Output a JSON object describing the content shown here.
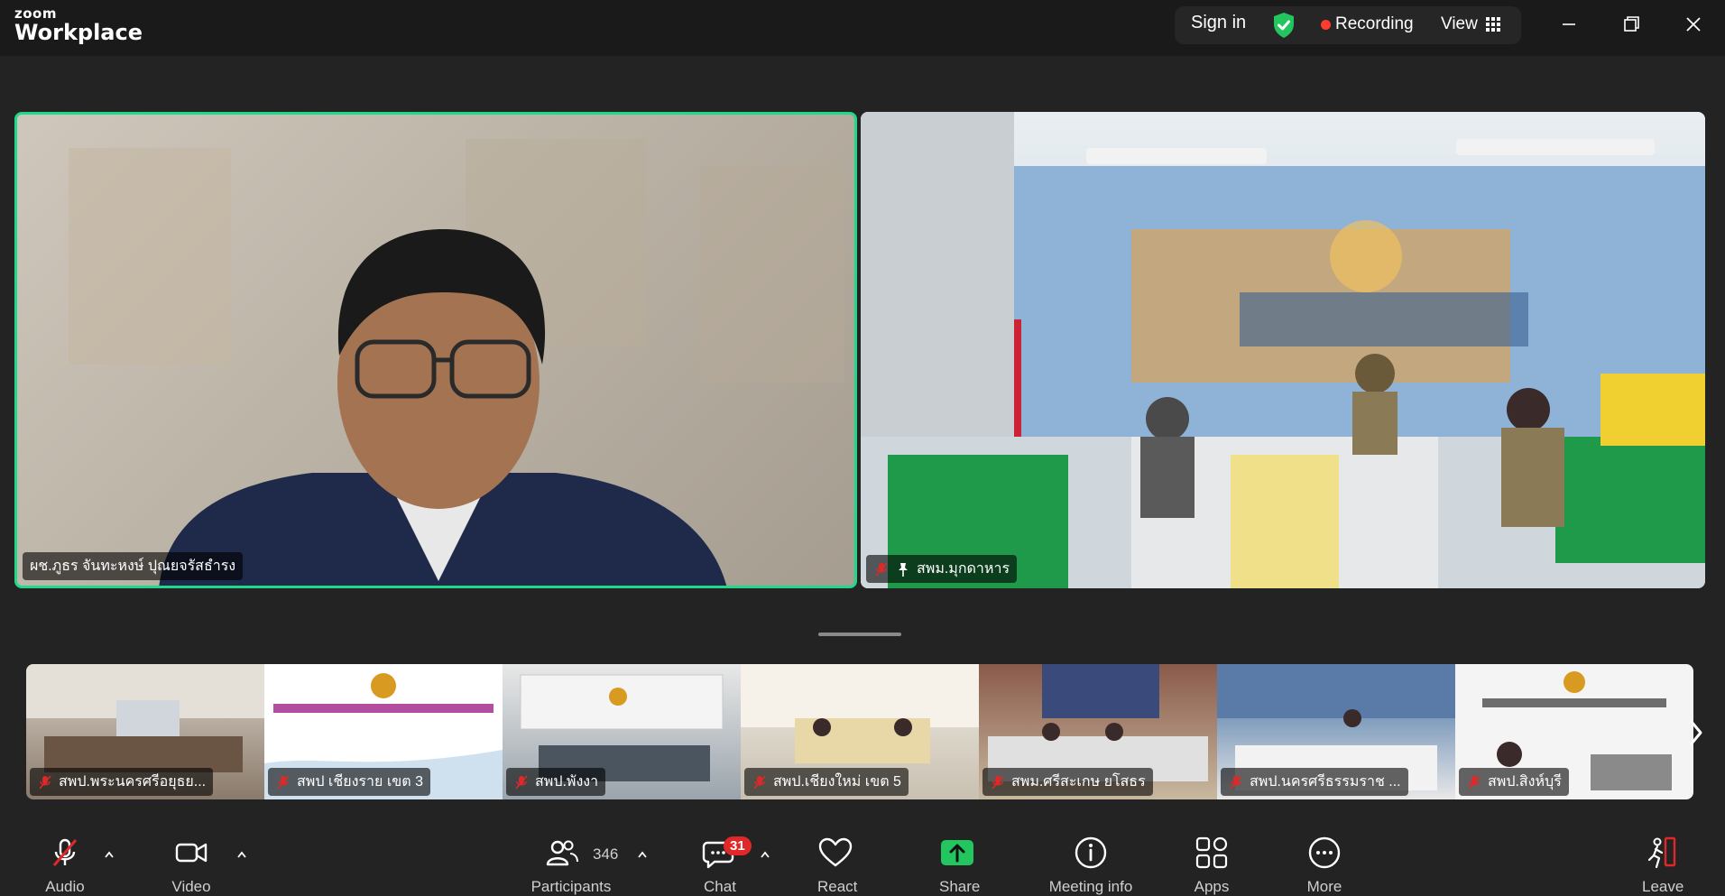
{
  "app": {
    "brand_small": "zoom",
    "brand_large": "Workplace"
  },
  "topbar": {
    "sign_in": "Sign in",
    "recording_label": "Recording",
    "view_label": "View",
    "colors": {
      "shield": "#22c55e",
      "record_dot": "#ff3b30"
    }
  },
  "main_tiles": [
    {
      "name": "ผช.ภูธร จันทะหงษ์ ปุณยจรัสธำรง",
      "active_speaker": true,
      "muted": false,
      "pinned": false
    },
    {
      "name": "สพม.มุกดาหาร",
      "active_speaker": false,
      "muted": true,
      "pinned": true
    }
  ],
  "filmstrip": [
    {
      "name": "สพป.พระนครศรีอยุธย..."
    },
    {
      "name": "สพป เชียงราย เขต 3"
    },
    {
      "name": "สพป.พังงา"
    },
    {
      "name": "สพป.เชียงใหม่ เขต 5"
    },
    {
      "name": "สพม.ศรีสะเกษ ยโสธร"
    },
    {
      "name": "สพป.นครศรีธรรมราช ..."
    },
    {
      "name": "สพป.สิงห์บุรี"
    }
  ],
  "toolbar": {
    "audio": "Audio",
    "video": "Video",
    "participants": "Participants",
    "participants_count": "346",
    "chat": "Chat",
    "chat_badge": "31",
    "react": "React",
    "share": "Share",
    "meeting_info": "Meeting info",
    "apps": "Apps",
    "more": "More",
    "leave": "Leave",
    "colors": {
      "share": "#22c55e",
      "leave": "#e02828",
      "badge": "#e02828"
    }
  }
}
